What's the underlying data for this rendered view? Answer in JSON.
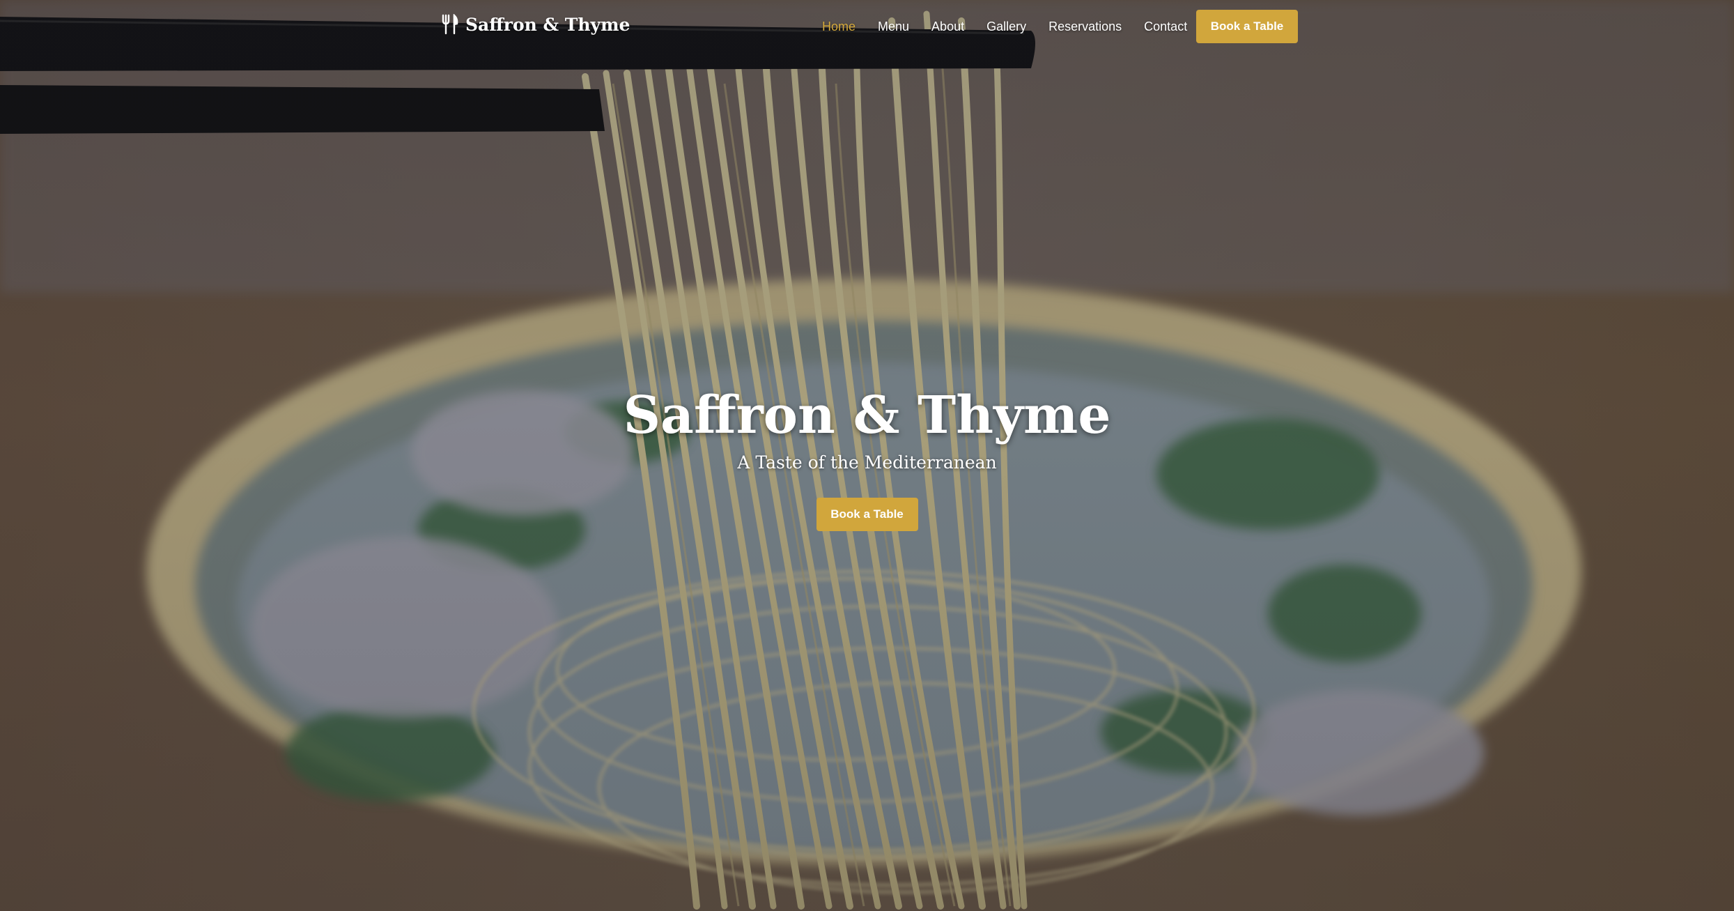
{
  "brand": {
    "name": "Saffron & Thyme",
    "icon": "fork-knife-icon"
  },
  "nav": {
    "links": [
      {
        "label": "Home",
        "active": true
      },
      {
        "label": "Menu",
        "active": false
      },
      {
        "label": "About",
        "active": false
      },
      {
        "label": "Gallery",
        "active": false
      },
      {
        "label": "Reservations",
        "active": false
      },
      {
        "label": "Contact",
        "active": false
      }
    ],
    "cta_label": "Book a Table"
  },
  "hero": {
    "title": "Saffron & Thyme",
    "subtitle": "A Taste of the Mediterranean",
    "cta_label": "Book a Table"
  },
  "colors": {
    "accent": "#d1a63c",
    "active_link": "#d4a93b",
    "text": "#ffffff"
  }
}
